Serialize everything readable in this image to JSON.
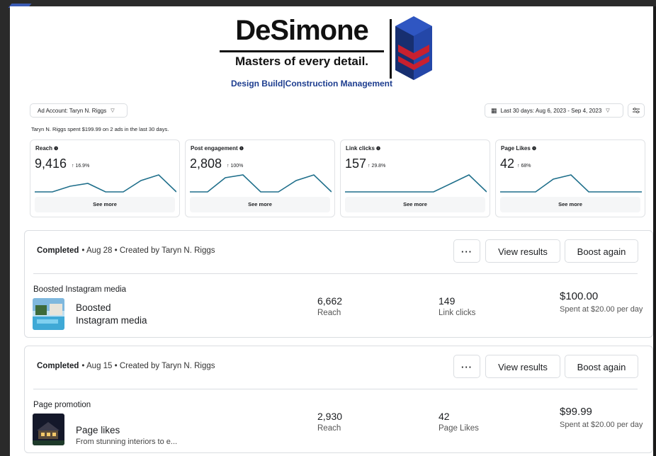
{
  "logo": {
    "name": "DeSimone",
    "tagline": "Masters of every detail.",
    "subtitle": "Design Build|Construction Management"
  },
  "header": {
    "ad_account": "Ad Account: Taryn N. Riggs",
    "date_range": "Last 30 days: Aug 6, 2023 - Sep 4, 2023",
    "spent_summary": "Taryn N. Riggs spent $199.99 on 2 ads in the last 30 days."
  },
  "metrics": [
    {
      "title": "Reach",
      "value": "9,416",
      "change": "↑ 16.9%",
      "see_more": "See more",
      "trend": [
        0,
        0,
        2,
        3,
        0,
        0,
        4,
        6,
        0
      ]
    },
    {
      "title": "Post engagement",
      "value": "2,808",
      "change": "↑ 100%",
      "see_more": "See more",
      "trend": [
        0,
        0,
        5,
        6,
        0,
        0,
        4,
        6,
        0
      ]
    },
    {
      "title": "Link clicks",
      "value": "157",
      "change": "↑ 29.8%",
      "see_more": "See more",
      "trend": [
        0,
        0,
        0,
        0,
        0,
        0,
        3,
        6,
        0
      ]
    },
    {
      "title": "Page Likes",
      "value": "42",
      "change": "↑ 68%",
      "see_more": "See more",
      "trend": [
        0,
        0,
        0,
        3,
        4,
        0,
        0,
        0,
        0
      ]
    }
  ],
  "campaigns": [
    {
      "status": "Completed",
      "meta": "• Aug 28 • Created by Taryn N. Riggs",
      "more": "···",
      "view": "View results",
      "boost": "Boost again",
      "kind": "Boosted Instagram media",
      "name_line1": "Boosted",
      "name_line2": "Instagram media",
      "stat1_value": "6,662",
      "stat1_label": "Reach",
      "stat2_value": "149",
      "stat2_label": "Link clicks",
      "amount": "$100.00",
      "per": "Spent at $20.00 per day"
    },
    {
      "status": "Completed",
      "meta": "• Aug 15 • Created by Taryn N. Riggs",
      "more": "···",
      "view": "View results",
      "boost": "Boost again",
      "kind": "Page promotion",
      "name_line1": "Page likes",
      "desc": "From stunning interiors to e...",
      "stat1_value": "2,930",
      "stat1_label": "Reach",
      "stat2_value": "42",
      "stat2_label": "Page Likes",
      "amount": "$99.99",
      "per": "Spent at $20.00 per day"
    }
  ],
  "colors": {
    "trend_line": "#1f6f8b",
    "logo_blue": "#1d3d8f",
    "logo_red": "#c8202f"
  }
}
